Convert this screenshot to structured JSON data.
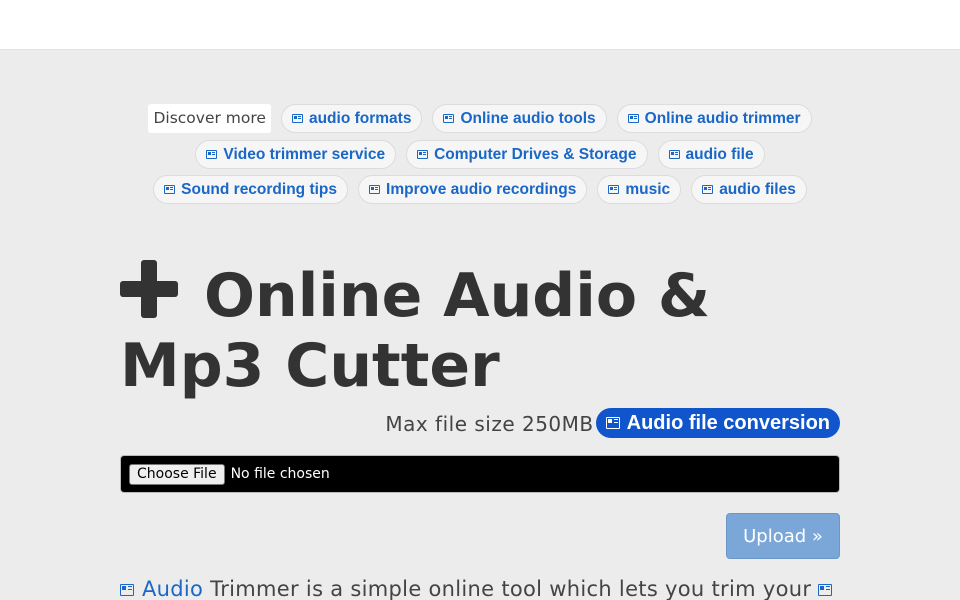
{
  "discover": {
    "label": "Discover more"
  },
  "chips": [
    {
      "label": "audio formats"
    },
    {
      "label": "Online audio tools"
    },
    {
      "label": "Online audio trimmer"
    },
    {
      "label": "Video trimmer service"
    },
    {
      "label": "Computer Drives & Storage"
    },
    {
      "label": "audio file"
    },
    {
      "label": "Sound recording tips"
    },
    {
      "label": "Improve audio recordings"
    },
    {
      "label": "music"
    },
    {
      "label": "audio files"
    }
  ],
  "title": "Online Audio & Mp3 Cutter",
  "max_size": "Max file size 250MB",
  "conversion_pill": "Audio file conversion",
  "file_input": {
    "button": "Choose File",
    "status": "No file chosen"
  },
  "upload_label": "Upload »",
  "description": {
    "link": "Audio",
    "text": " Trimmer is a simple online tool which lets you trim your "
  },
  "icons": {
    "chip_icon": "news-icon",
    "title_icon": "plus-icon"
  },
  "colors": {
    "accent": "#1a67c7",
    "pill": "#1155cc",
    "upload": "#7aa7d8"
  }
}
